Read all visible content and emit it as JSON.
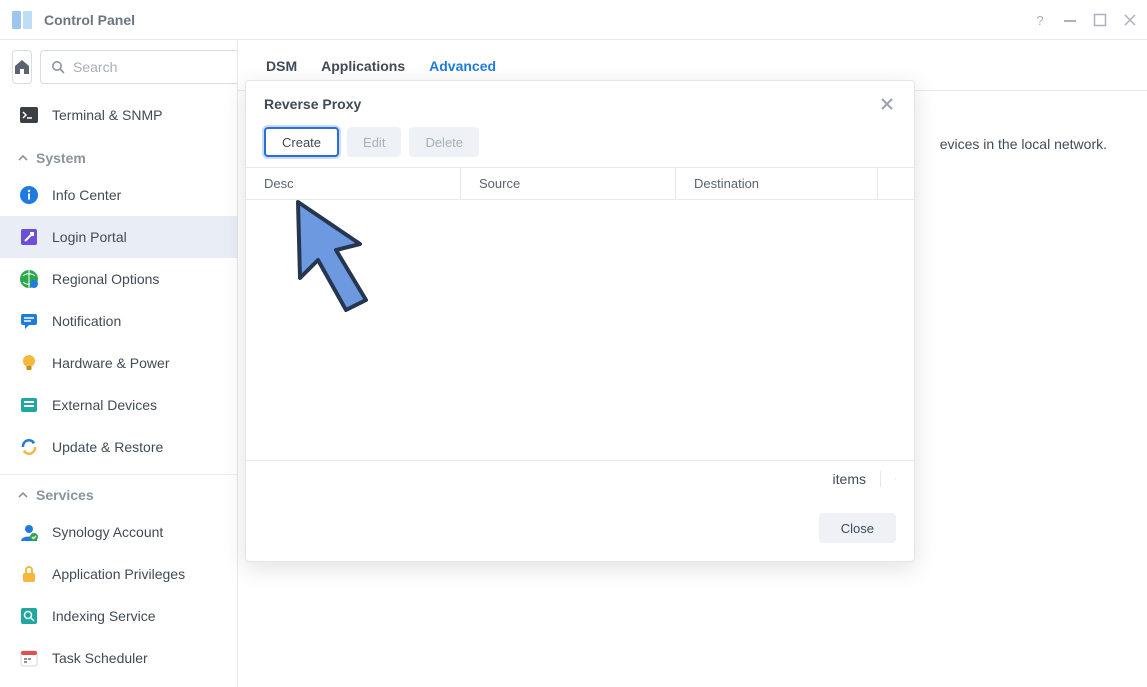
{
  "window": {
    "title": "Control Panel"
  },
  "search": {
    "placeholder": "Search"
  },
  "sidebar": {
    "top_item": "Terminal & SNMP",
    "sections": [
      {
        "label": "System",
        "items": [
          "Info Center",
          "Login Portal",
          "Regional Options",
          "Notification",
          "Hardware & Power",
          "External Devices",
          "Update & Restore"
        ]
      },
      {
        "label": "Services",
        "items": [
          "Synology Account",
          "Application Privileges",
          "Indexing Service",
          "Task Scheduler"
        ]
      }
    ]
  },
  "tabs": [
    "DSM",
    "Applications",
    "Advanced"
  ],
  "section": {
    "title": "Reverse Proxy",
    "description_suffix": "evices in the local network."
  },
  "dialog": {
    "title": "Reverse Proxy",
    "buttons": {
      "create": "Create",
      "edit": "Edit",
      "delete": "Delete",
      "close": "Close"
    },
    "columns": [
      "Description",
      "Source",
      "Destination"
    ],
    "col0_visible": "Desc",
    "status": "items"
  }
}
